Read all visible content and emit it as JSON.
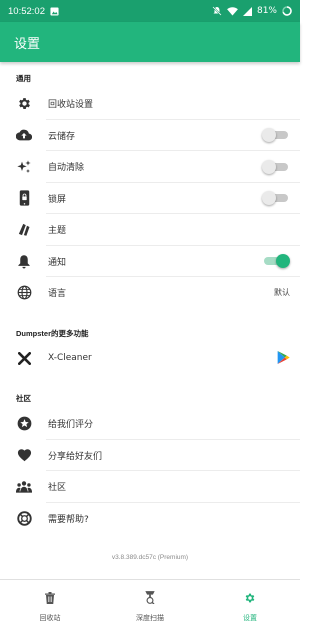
{
  "status_bar": {
    "time": "10:52:02",
    "battery": "81%"
  },
  "app_bar": {
    "title": "设置"
  },
  "colors": {
    "accent": "#22b57d",
    "status_bar": "#1aa06e"
  },
  "sections": {
    "general": {
      "header": "通用",
      "items": [
        {
          "label": "回收站设置",
          "icon": "gear-icon"
        },
        {
          "label": "云储存",
          "icon": "cloud-upload-icon",
          "toggle": false
        },
        {
          "label": "自动清除",
          "icon": "sparkle-icon",
          "toggle": false
        },
        {
          "label": "锁屏",
          "icon": "lock-screen-icon",
          "toggle": false
        },
        {
          "label": "主题",
          "icon": "theme-icon"
        },
        {
          "label": "通知",
          "icon": "bell-icon",
          "toggle": true
        },
        {
          "label": "语言",
          "icon": "globe-icon",
          "value": "默认"
        }
      ]
    },
    "more": {
      "header": "Dumpster的更多功能",
      "items": [
        {
          "label": "X-Cleaner",
          "icon": "x-cleaner-icon"
        }
      ]
    },
    "community": {
      "header": "社区",
      "items": [
        {
          "label": "给我们评分",
          "icon": "star-icon"
        },
        {
          "label": "分享给好友们",
          "icon": "heart-icon"
        },
        {
          "label": "社区",
          "icon": "community-icon"
        },
        {
          "label": "需要帮助?",
          "icon": "help-icon"
        }
      ]
    }
  },
  "version": "v3.8.389.dc57c (Premium)",
  "bottom_nav": [
    {
      "label": "回收站",
      "icon": "trash-icon"
    },
    {
      "label": "深度扫描",
      "icon": "deep-scan-icon"
    },
    {
      "label": "设置",
      "icon": "gear-icon",
      "active": true
    }
  ]
}
